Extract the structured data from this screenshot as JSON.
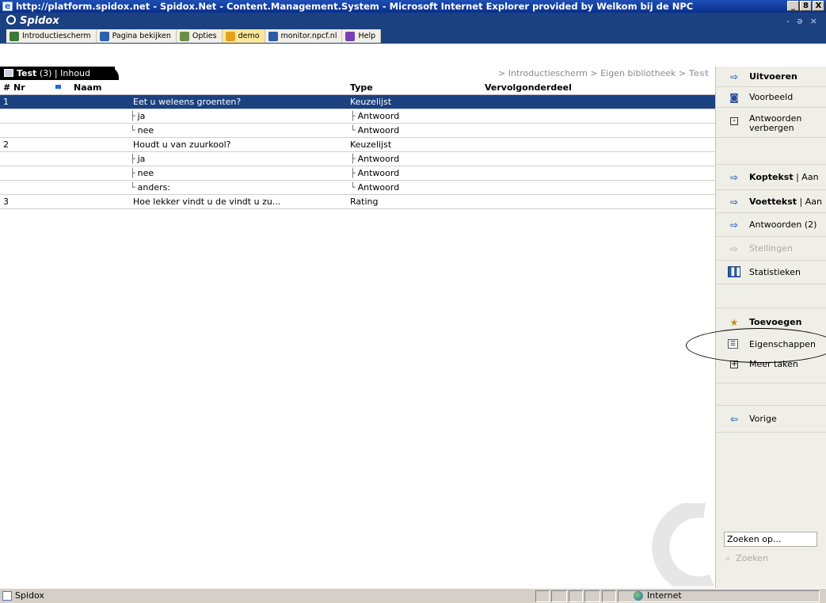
{
  "window": {
    "title": "http://platform.spidox.net - Spidox.Net - Content.Management.System - Microsoft Internet Explorer provided by Welkom bij de NPC",
    "controls": [
      "_",
      "8",
      "X"
    ]
  },
  "app": {
    "logo": "Spidox",
    "window_controls": "- ə ×"
  },
  "toolbar": {
    "items": [
      {
        "label": "Introductiescherm",
        "icon": "home-icon",
        "color": "#3a7a3a"
      },
      {
        "label": "Pagina bekijken",
        "icon": "view-page-icon",
        "color": "#2f5fb0"
      },
      {
        "label": "Opties",
        "icon": "gear-icon",
        "color": "#6a8f4a"
      },
      {
        "label": "demo",
        "icon": "user-icon",
        "color": "#e2a21c",
        "active": true
      },
      {
        "label": "monitor.npcf.nl",
        "icon": "network-icon",
        "color": "#2a5aa8"
      },
      {
        "label": "Help",
        "icon": "help-icon",
        "color": "#7a3fb8"
      }
    ]
  },
  "content": {
    "tab": {
      "title": "Test",
      "count": "(3)",
      "sep": "|",
      "section": "Inhoud"
    },
    "breadcrumb": {
      "path": "> Introductiescherm > Eigen bibliotheek > ",
      "current": "Test"
    },
    "columns": {
      "nr": "# Nr",
      "naam": "Naam",
      "type": "Type",
      "vervolg": "Vervolgonderdeel"
    },
    "rows": [
      {
        "nr": "1",
        "naam": "Eet u weleens groenten?",
        "type": "Keuzelijst",
        "kind": "question",
        "selected": true
      },
      {
        "nr": "",
        "naam": "ja",
        "type": "Antwoord",
        "kind": "answer",
        "tree": "├",
        "ttree": "├"
      },
      {
        "nr": "",
        "naam": "nee",
        "type": "Antwoord",
        "kind": "answer",
        "tree": "└",
        "ttree": "└"
      },
      {
        "nr": "2",
        "naam": "Houdt u van zuurkool?",
        "type": "Keuzelijst",
        "kind": "question"
      },
      {
        "nr": "",
        "naam": "ja",
        "type": "Antwoord",
        "kind": "answer",
        "tree": "├",
        "ttree": "├"
      },
      {
        "nr": "",
        "naam": "nee",
        "type": "Antwoord",
        "kind": "answer",
        "tree": "├",
        "ttree": "├"
      },
      {
        "nr": "",
        "naam": "anders:",
        "type": "Antwoord",
        "kind": "answer",
        "tree": "└",
        "ttree": "└"
      },
      {
        "nr": "3",
        "naam": "Hoe lekker vindt u de vindt u zu...",
        "type": "Rating",
        "kind": "question"
      }
    ]
  },
  "actions": {
    "uitvoeren": "Uitvoeren",
    "voorbeeld": "Voorbeeld",
    "antwoorden_verbergen_1": "Antwoorden",
    "antwoorden_verbergen_2": "verbergen",
    "koptekst": "Koptekst",
    "koptekst_state": "| Aan",
    "voettekst": "Voettekst",
    "voettekst_state": "| Aan",
    "antwoorden": "Antwoorden (2)",
    "stellingen": "Stellingen",
    "statistieken": "Statistieken",
    "toevoegen": "Toevoegen",
    "eigenschappen": "Eigenschappen",
    "meer_taken": "Meer taken",
    "vorige": "Vorige"
  },
  "search": {
    "value": "Zoeken op...",
    "button": "Zoeken"
  },
  "status": {
    "text": "Spidox",
    "zone": "Internet"
  },
  "colors": {
    "header_blue": "#1b4180",
    "selection": "#1b4180",
    "pane_bg": "#f0efe7"
  }
}
